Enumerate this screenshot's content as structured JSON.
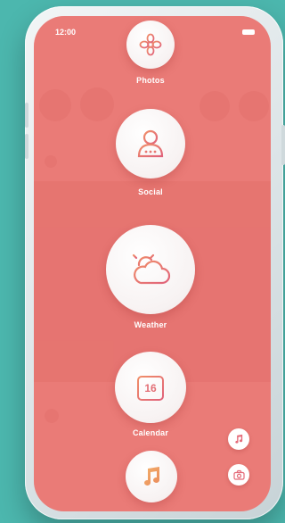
{
  "status_bar": {
    "time": "12:00"
  },
  "menu": {
    "items": [
      {
        "label": "Photos",
        "icon": "flower-icon"
      },
      {
        "label": "Social",
        "icon": "person-icon"
      },
      {
        "label": "Weather",
        "icon": "cloud-sun-icon"
      },
      {
        "label": "Calendar",
        "icon": "calendar-icon",
        "day": "16"
      },
      {
        "label": "",
        "icon": "music-note-icon"
      }
    ]
  },
  "quick_actions": [
    {
      "icon": "music-note-icon"
    },
    {
      "icon": "camera-icon"
    }
  ],
  "colors": {
    "accent": "#ea7d79",
    "icon_gradient_start": "#f08f6a",
    "icon_gradient_end": "#e0627a"
  }
}
